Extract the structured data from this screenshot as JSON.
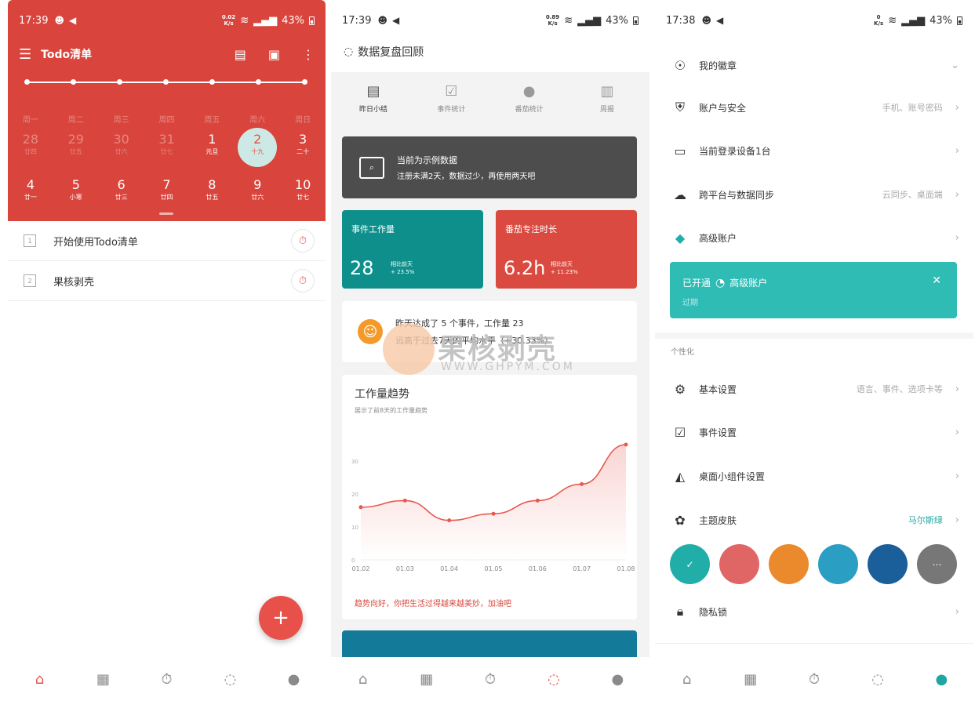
{
  "panel1": {
    "status": {
      "time": "17:39",
      "speed_top": "0.02",
      "speed_unit": "K/s",
      "battery": "43%"
    },
    "toolbar": {
      "title": "Todo清单"
    },
    "weekdays": [
      "周一",
      "周二",
      "周三",
      "周四",
      "周五",
      "周六",
      "周日"
    ],
    "row1": [
      {
        "day": "28",
        "sub": "廿四"
      },
      {
        "day": "29",
        "sub": "廿五"
      },
      {
        "day": "30",
        "sub": "廿六"
      },
      {
        "day": "31",
        "sub": "廿七"
      },
      {
        "day": "1",
        "sub": "元旦"
      },
      {
        "day": "2",
        "sub": "十九"
      },
      {
        "day": "3",
        "sub": "二十"
      }
    ],
    "row2": [
      {
        "day": "4",
        "sub": "廿一"
      },
      {
        "day": "5",
        "sub": "小寒"
      },
      {
        "day": "6",
        "sub": "廿三"
      },
      {
        "day": "7",
        "sub": "廿四"
      },
      {
        "day": "8",
        "sub": "廿五"
      },
      {
        "day": "9",
        "sub": "廿六"
      },
      {
        "day": "10",
        "sub": "廿七"
      }
    ],
    "tasks": [
      {
        "index": "1",
        "title": "开始使用Todo清单"
      },
      {
        "index": "2",
        "title": "果核剥壳"
      }
    ],
    "fab": "+"
  },
  "panel2": {
    "status": {
      "time": "17:39",
      "speed_top": "0.89",
      "speed_unit": "K/s",
      "battery": "43%"
    },
    "title": "数据复盘回顾",
    "tabs": [
      "昨日小结",
      "事件统计",
      "番茄统计",
      "周报"
    ],
    "sample": {
      "line1": "当前为示例数据",
      "line2": "注册未满2天，数据过少，再使用两天吧"
    },
    "card_work": {
      "label": "事件工作量",
      "value": "28",
      "cmp1": "相比前天",
      "cmp2": "+ 23.5%"
    },
    "card_tomato": {
      "label": "番茄专注时长",
      "value": "6.2h",
      "cmp1": "相比前天",
      "cmp2": "+ 11.23%"
    },
    "summary": {
      "line1": "昨天达成了 5 个事件，工作量 23",
      "line2": "远高于过去7天的平均水平（+30.33%）"
    },
    "trend": {
      "title": "工作量趋势",
      "subtitle": "展示了前8天的工作量趋势",
      "footer": "趋势向好，你把生活过得越来越美妙，加油吧"
    },
    "chart_data": {
      "type": "area",
      "categories": [
        "01.02",
        "01.03",
        "01.04",
        "01.05",
        "01.06",
        "01.07",
        "01.08"
      ],
      "series": [
        {
          "values": [
            16,
            18,
            12,
            14,
            18,
            23,
            35
          ]
        }
      ],
      "yticks": [
        "0",
        "10",
        "20",
        "30"
      ],
      "ylim": [
        0,
        40
      ],
      "color": "#e8584f"
    }
  },
  "panel3": {
    "status": {
      "time": "17:38",
      "speed_top": "0",
      "speed_unit": "K/s",
      "battery": "43%"
    },
    "rows_top": [
      {
        "label": "我的徽章",
        "hint": ""
      },
      {
        "label": "账户与安全",
        "hint": "手机、账号密码"
      },
      {
        "label": "当前登录设备1台",
        "hint": ""
      },
      {
        "label": "跨平台与数据同步",
        "hint": "云同步、桌面端"
      },
      {
        "label": "高级账户",
        "hint": ""
      }
    ],
    "premium": {
      "label1": "已开通",
      "label2": "高级账户",
      "sub": "过期"
    },
    "section": "个性化",
    "rows_personal": [
      {
        "label": "基本设置",
        "hint": "语言、事件、选项卡等"
      },
      {
        "label": "事件设置",
        "hint": ""
      },
      {
        "label": "桌面小组件设置",
        "hint": ""
      },
      {
        "label": "主题皮肤",
        "hint": "马尔斯绿"
      }
    ],
    "swatch_colors": [
      "#21aea8",
      "#e06565",
      "#ea8a2c",
      "#2a9ec3",
      "#1a5e9a",
      "#777777"
    ],
    "privacy": "隐私锁"
  },
  "watermark": {
    "text": "果核剥壳",
    "url": "WWW.GHPYM.COM"
  }
}
